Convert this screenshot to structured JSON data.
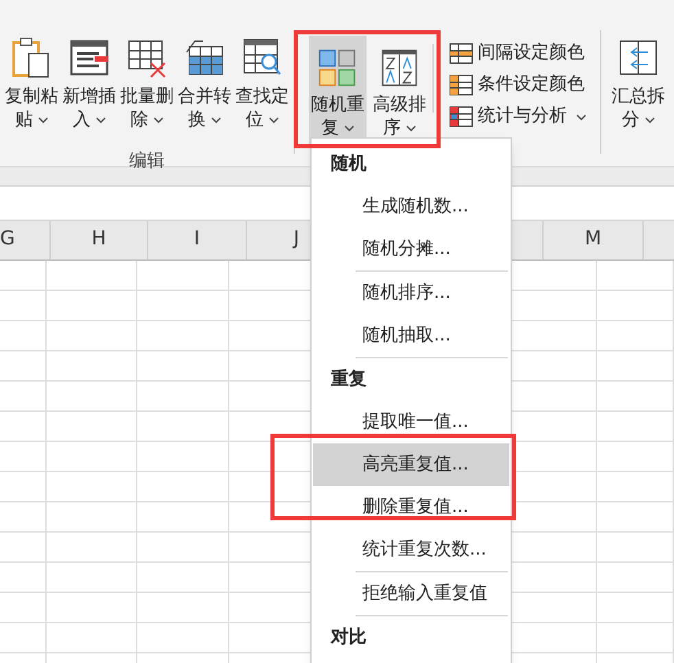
{
  "ribbon": {
    "edit_group": {
      "label": "编辑",
      "buttons": [
        {
          "lines": [
            "复制粘",
            "贴"
          ]
        },
        {
          "lines": [
            "新增插",
            "入"
          ]
        },
        {
          "lines": [
            "批量删",
            "除"
          ]
        },
        {
          "lines": [
            "合并转",
            "换"
          ]
        },
        {
          "lines": [
            "查找定",
            "位"
          ]
        }
      ]
    },
    "random_buttons": [
      {
        "lines": [
          "随机重",
          "复"
        ],
        "selected": true
      },
      {
        "lines": [
          "高级排",
          "序"
        ],
        "selected": false
      }
    ],
    "small_buttons": [
      {
        "label": "间隔设定颜色",
        "dropdown": false
      },
      {
        "label": "条件设定颜色",
        "dropdown": false
      },
      {
        "label": "统计与分析",
        "dropdown": true
      }
    ],
    "summary_button": {
      "lines": [
        "汇总拆",
        "分"
      ]
    }
  },
  "columns": [
    {
      "label": "G"
    },
    {
      "label": "H"
    },
    {
      "label": "I"
    },
    {
      "label": "J"
    },
    {
      "label": "M"
    }
  ],
  "menu": {
    "items": [
      {
        "kind": "header",
        "label": "随机"
      },
      {
        "kind": "item",
        "label": "生成随机数...",
        "selected": false
      },
      {
        "kind": "item",
        "label": "随机分摊...",
        "selected": false
      },
      {
        "kind": "separator"
      },
      {
        "kind": "item",
        "label": "随机排序...",
        "selected": false
      },
      {
        "kind": "item",
        "label": "随机抽取...",
        "selected": false
      },
      {
        "kind": "separator"
      },
      {
        "kind": "header",
        "label": "重复"
      },
      {
        "kind": "item",
        "label": "提取唯一值...",
        "selected": false
      },
      {
        "kind": "item",
        "label": "高亮重复值...",
        "selected": true
      },
      {
        "kind": "item",
        "label": "删除重复值...",
        "selected": false
      },
      {
        "kind": "item",
        "label": "统计重复次数...",
        "selected": false
      },
      {
        "kind": "separator"
      },
      {
        "kind": "item",
        "label": "拒绝输入重复值",
        "selected": false
      },
      {
        "kind": "separator"
      },
      {
        "kind": "header",
        "label": "对比"
      }
    ]
  }
}
